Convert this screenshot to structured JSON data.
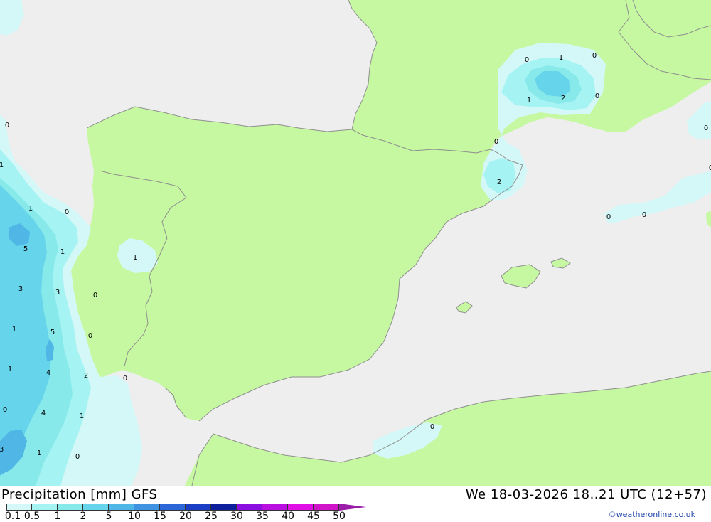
{
  "title": {
    "left": "Precipitation [mm] GFS",
    "right": "We 18-03-2026 18..21 UTC (12+57)"
  },
  "credit": "©weatheronline.co.uk",
  "legend": {
    "values": [
      "0.1",
      "0.5",
      "1",
      "2",
      "5",
      "10",
      "15",
      "20",
      "25",
      "30",
      "35",
      "40",
      "45",
      "50"
    ],
    "colors": [
      "#d4f8f8",
      "#a6f3f3",
      "#87e9ea",
      "#66d4ea",
      "#4fb6e6",
      "#3f93e0",
      "#2c66d8",
      "#1a3fc4",
      "#0d1f9a",
      "#8a0fe0",
      "#b90fe0",
      "#e00fe6",
      "#d014c8",
      "#9b1ea8"
    ]
  },
  "colors": {
    "land": "#c5f8a0",
    "sea": "#eeeeee",
    "border": "#8f8f8f",
    "contour_0": "#d4f8f8",
    "contour_1": "#a6f3f3",
    "contour_2": "#87e9ea",
    "contour_5": "#66d4ea"
  },
  "contour_labels": [
    "0",
    "1",
    "0",
    "1",
    "2",
    "0",
    "0",
    "0",
    "2",
    "0",
    "0",
    "0",
    "1",
    "1",
    "0",
    "5",
    "1",
    "3",
    "3",
    "0",
    "1",
    "5",
    "0",
    "1",
    "4",
    "2",
    "0",
    "0",
    "4",
    "1",
    "3",
    "1",
    "0",
    "0",
    "0",
    "1"
  ]
}
